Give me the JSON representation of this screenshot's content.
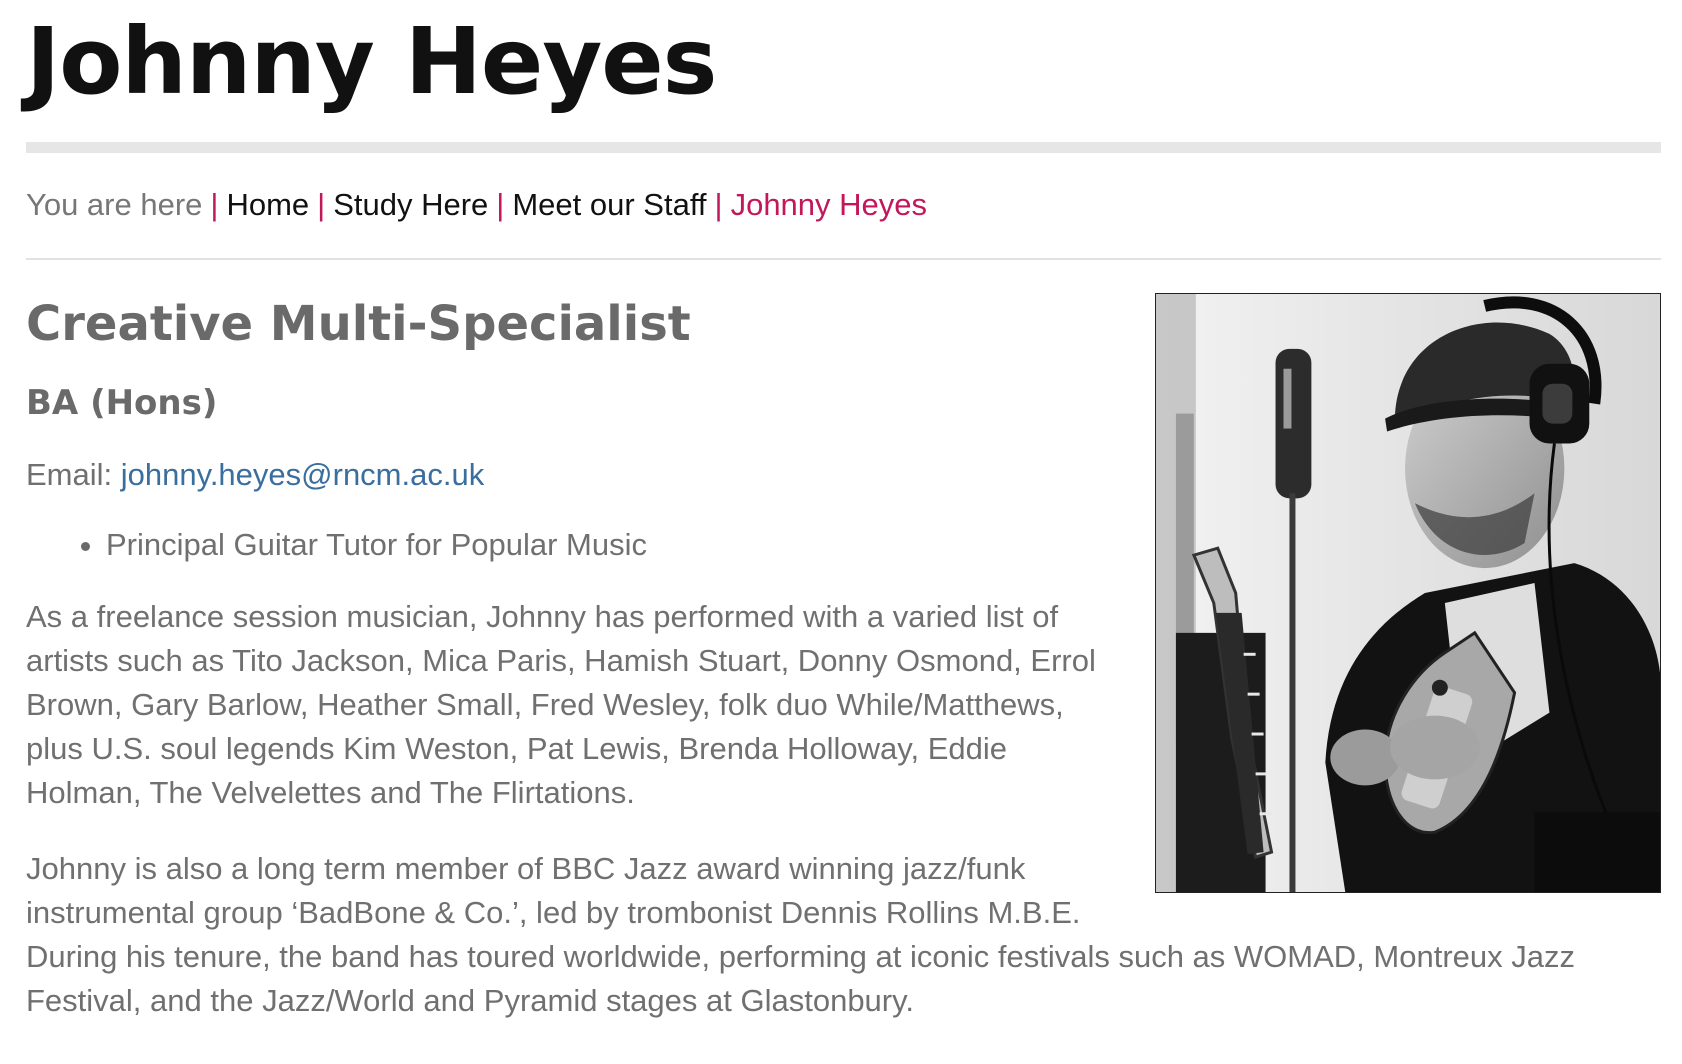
{
  "header": {
    "title": "Johnny Heyes"
  },
  "breadcrumb": {
    "prefix": "You are here",
    "separator": "|",
    "items": [
      "Home",
      "Study Here",
      "Meet our Staff"
    ],
    "current": "Johnny Heyes"
  },
  "profile": {
    "role": "Creative Multi-Specialist",
    "qualification": "BA (Hons)",
    "email_label": "Email:",
    "email": "johnny.heyes@rncm.ac.uk",
    "positions": [
      "Principal Guitar Tutor for Popular Music"
    ],
    "bio": [
      "As a freelance session musician, Johnny has performed with a varied list of artists such as Tito Jackson, Mica Paris, Hamish Stuart, Donny Osmond, Errol Brown, Gary Barlow, Heather Small, Fred Wesley, folk duo While/Matthews, plus U.S. soul legends Kim Weston, Pat Lewis, Brenda Holloway, Eddie Holman, The Velvelettes and The Flirtations.",
      "Johnny is also a long term member of BBC Jazz award winning jazz/funk instrumental group ‘BadBone & Co.’, led by trombonist Dennis Rollins M.B.E. During his tenure, the band has toured worldwide, performing at iconic festivals such as WOMAD, Montreux Jazz Festival, and the Jazz/World and Pyramid stages at Glastonbury."
    ]
  },
  "colors": {
    "accent": "#c2185b",
    "link": "#3a6e9e",
    "body_text": "#707070",
    "title": "#111111"
  }
}
